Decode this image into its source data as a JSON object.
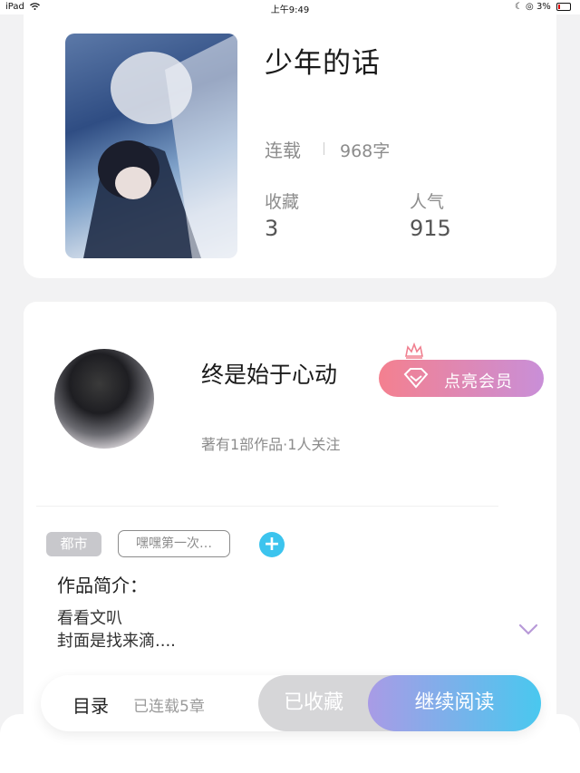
{
  "status_bar": {
    "device": "iPad",
    "time": "上午9:49",
    "battery": "3%"
  },
  "book": {
    "title": "少年的话",
    "status": "连载",
    "word_count": "968字",
    "favorites_label": "收藏",
    "favorites_value": "3",
    "popularity_label": "人气",
    "popularity_value": "915"
  },
  "author": {
    "name": "终是始于心动",
    "vip_button": "点亮会员",
    "meta": "著有1部作品·1人关注"
  },
  "tags": {
    "category": "都市",
    "custom": "嘿嘿第一次…"
  },
  "intro": {
    "heading": "作品简介：",
    "line1": "看看文叭",
    "line2": "封面是找来滴...."
  },
  "bottom_bar": {
    "toc_label": "目录",
    "chapters": "已连载5章",
    "favorited_button": "已收藏",
    "read_button": "继续阅读"
  },
  "colors": {
    "vip_gradient_start": "#f4808f",
    "vip_gradient_end": "#c98fd8",
    "read_gradient_start": "#a99be6",
    "read_gradient_end": "#49c8ef",
    "plus_button": "#3cc4ee"
  }
}
